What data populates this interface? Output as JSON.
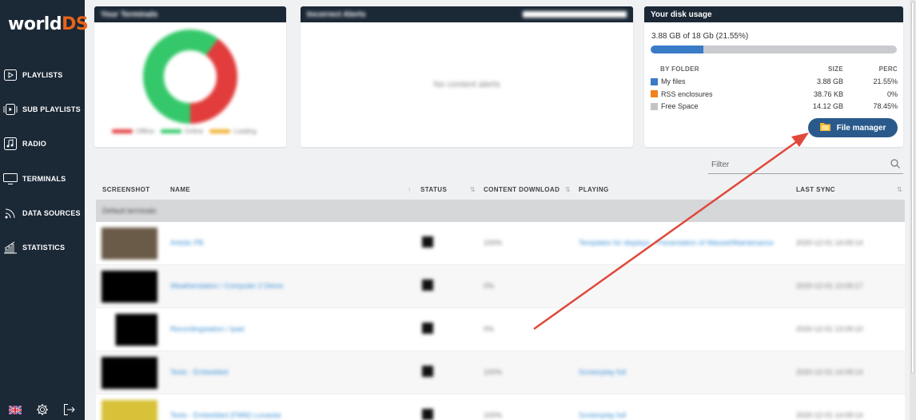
{
  "brand": {
    "logo_main": "world",
    "logo_accent": "DS"
  },
  "sidebar": {
    "items": [
      {
        "label": "PLAYLISTS",
        "icon": "play-icon"
      },
      {
        "label": "SUB PLAYLISTS",
        "icon": "sub-playlist-icon"
      },
      {
        "label": "RADIO",
        "icon": "music-note-icon"
      },
      {
        "label": "TERMINALS",
        "icon": "monitor-icon"
      },
      {
        "label": "DATA SOURCES",
        "icon": "rss-icon"
      },
      {
        "label": "STATISTICS",
        "icon": "bar-chart-icon"
      }
    ],
    "bottom_icons": [
      "uk-flag-icon",
      "gear-icon",
      "logout-icon"
    ]
  },
  "cards": {
    "status_card": {
      "title": "Your Terminals",
      "donut": {
        "offline_fraction": 0.4,
        "online_fraction": 0.6
      },
      "legend": [
        "Offline",
        "Online",
        "Loading"
      ]
    },
    "content_card": {
      "title": "Incorrect Alerts",
      "empty_text": "No content alerts"
    },
    "disk_card": {
      "title": "Your disk usage",
      "usage_text": "3.88 GB of 18 Gb (21.55%)",
      "usage_fraction": 0.2155,
      "headers": {
        "folder": "BY FOLDER",
        "size": "SIZE",
        "perc": "PERC"
      },
      "folders": [
        {
          "name": "My files",
          "size": "3.88 GB",
          "perc": "21.55%",
          "color": "#3a7bc8"
        },
        {
          "name": "RSS enclosures",
          "size": "38.76 KB",
          "perc": "0%",
          "color": "#f0821e"
        },
        {
          "name": "Free Space",
          "size": "14.12 GB",
          "perc": "78.45%",
          "color": "#c4c4c4"
        }
      ],
      "button_label": "File manager"
    }
  },
  "filter": {
    "placeholder": "Filter"
  },
  "table": {
    "headers": {
      "screenshot": "SCREENSHOT",
      "name": "NAME",
      "status": "STATUS",
      "content_download": "CONTENT DOWNLOAD",
      "playing": "PLAYING",
      "last_sync": "LAST SYNC"
    },
    "group_label": "Default terminals",
    "rows": [
      {
        "name": "Artistic PB",
        "download": "100%",
        "playing": "Templates for displays - Presentation of Wasset/Maintenance",
        "last_sync": "2020-12-01 14:09:14"
      },
      {
        "name": "Weatherstation / Computer 2 Demo",
        "download": "0%",
        "playing": "",
        "last_sync": "2020-12-01 13:09:17"
      },
      {
        "name": "Recordingstation / Ipad",
        "download": "0%",
        "playing": "",
        "last_sync": "2020-12-01 13:09:10"
      },
      {
        "name": "Tests - Embedded",
        "download": "100%",
        "playing": "Screenplay full",
        "last_sync": "2020-12-01 14:09:14"
      },
      {
        "name": "Tests - Embedded (FMM) Lunastar",
        "download": "100%",
        "playing": "Screenplay full",
        "last_sync": "2020-12-01 14:09:14"
      }
    ]
  }
}
